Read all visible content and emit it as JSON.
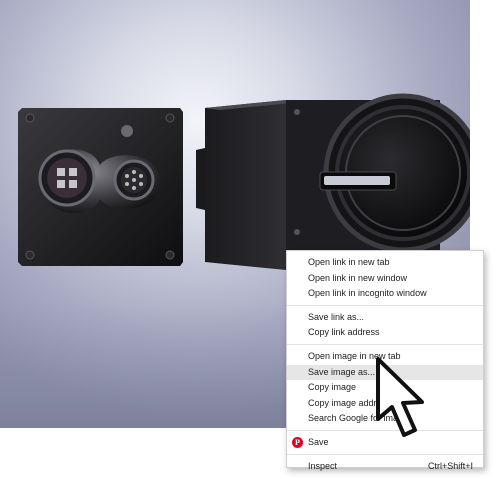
{
  "context_menu": {
    "items": [
      {
        "label": "Open link in new tab"
      },
      {
        "label": "Open link in new window"
      },
      {
        "label": "Open link in incognito window"
      },
      {
        "label": "Save link as..."
      },
      {
        "label": "Copy link address"
      },
      {
        "label": "Open image in new tab"
      },
      {
        "label": "Save image as...",
        "highlighted": true
      },
      {
        "label": "Copy image"
      },
      {
        "label": "Copy image address"
      },
      {
        "label": "Search Google for image"
      },
      {
        "label": "Save",
        "icon": "pinterest-icon"
      },
      {
        "label": "Inspect",
        "shortcut": "Ctrl+Shift+I"
      }
    ]
  },
  "pinterest_glyph": "P",
  "colors": {
    "menu_highlight": "#e6e6e6",
    "pinterest": "#e60023",
    "backdrop": "#a7aac2"
  }
}
